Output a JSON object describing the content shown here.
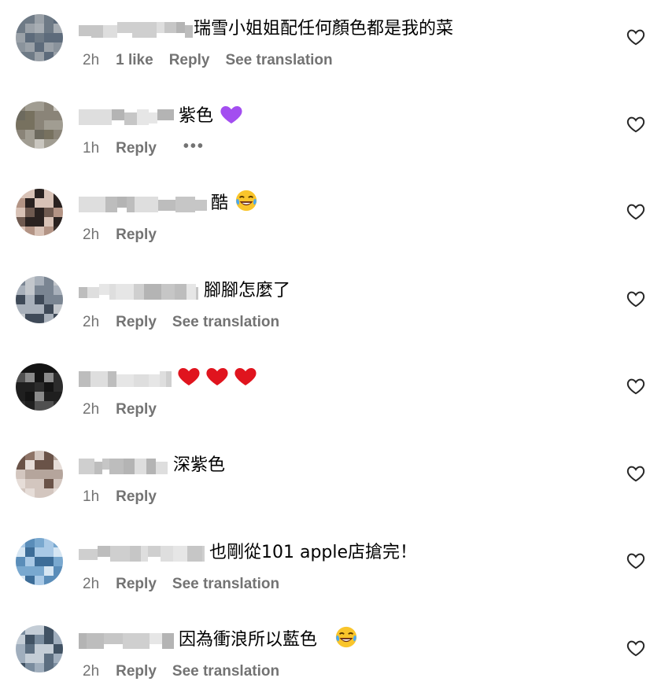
{
  "comments": [
    {
      "text": "瑞雪小姐姐配任何顏色都是我的菜",
      "time": "2h",
      "likes": "1 like",
      "reply": "Reply",
      "translate": "See translation",
      "emoji": []
    },
    {
      "text": "紫色",
      "time": "1h",
      "reply": "Reply",
      "more": "•••",
      "emoji": [
        "purple-heart"
      ]
    },
    {
      "text": "酷",
      "time": "2h",
      "reply": "Reply",
      "emoji": [
        "laughing-tears"
      ]
    },
    {
      "text": "腳腳怎麼了",
      "time": "2h",
      "reply": "Reply",
      "translate": "See translation",
      "emoji": []
    },
    {
      "text": "",
      "time": "2h",
      "reply": "Reply",
      "emoji": [
        "red-heart",
        "red-heart",
        "red-heart"
      ]
    },
    {
      "text": "深紫色",
      "time": "1h",
      "reply": "Reply",
      "emoji": []
    },
    {
      "text": "也剛從101 apple店搶完！",
      "time": "2h",
      "reply": "Reply",
      "translate": "See translation",
      "emoji": []
    },
    {
      "text": "因為衝浪所以藍色",
      "time": "2h",
      "reply": "Reply",
      "translate": "See translation",
      "emoji": [
        "laughing-tears"
      ]
    }
  ],
  "colors": {
    "meta": "#737373",
    "heart_outline": "#262626",
    "red_heart": "#e0141e",
    "purple_heart": "#a34ef0",
    "emoji_yellow": "#f9c52b"
  }
}
